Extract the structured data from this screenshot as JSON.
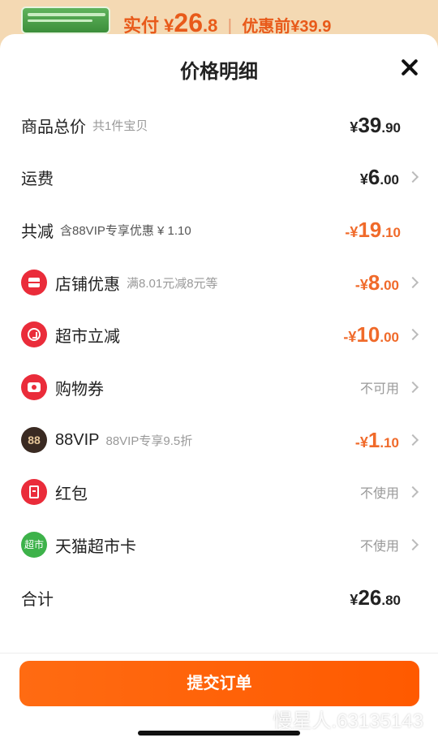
{
  "top_bar": {
    "paid_label": "实付",
    "paid_currency": "¥",
    "paid_int": "26",
    "paid_dec": ".8",
    "separator": "|",
    "orig_label": "优惠前",
    "orig_price": "¥39.9"
  },
  "sheet": {
    "title": "价格明细"
  },
  "rows": {
    "total_goods": {
      "label": "商品总价",
      "sub": "共1件宝贝",
      "currency": "¥",
      "int": "39",
      "dec": ".90"
    },
    "shipping": {
      "label": "运费",
      "currency": "¥",
      "int": "6",
      "dec": ".00"
    },
    "total_reduce": {
      "label": "共减",
      "sub": "含88VIP专享优惠 ¥ 1.10",
      "currency": "-¥",
      "int": "19",
      "dec": ".10"
    },
    "shop_discount": {
      "label": "店铺优惠",
      "sub": "满8.01元减8元等",
      "currency": "-¥",
      "int": "8",
      "dec": ".00"
    },
    "super_reduce": {
      "label": "超市立减",
      "currency": "-¥",
      "int": "10",
      "dec": ".00"
    },
    "coupon": {
      "label": "购物券",
      "status": "不可用"
    },
    "vip": {
      "icon_text": "88",
      "label": "88VIP",
      "sub": "88VIP专享9.5折",
      "currency": "-¥",
      "int": "1",
      "dec": ".10"
    },
    "red_packet": {
      "label": "红包",
      "status": "不使用"
    },
    "tmall_card": {
      "icon_text": "超市",
      "label": "天猫超市卡",
      "status": "不使用"
    },
    "sum": {
      "label": "合计",
      "currency": "¥",
      "int": "26",
      "dec": ".80"
    }
  },
  "actions": {
    "submit_label": "提交订单"
  },
  "watermark": "慢星人.63135143",
  "colors": {
    "accent_orange": "#f06a2a",
    "button_orange": "#ff5a00",
    "icon_red": "#ea2c3a",
    "vip_dark": "#3a2a22",
    "tmall_green": "#3db24a"
  }
}
